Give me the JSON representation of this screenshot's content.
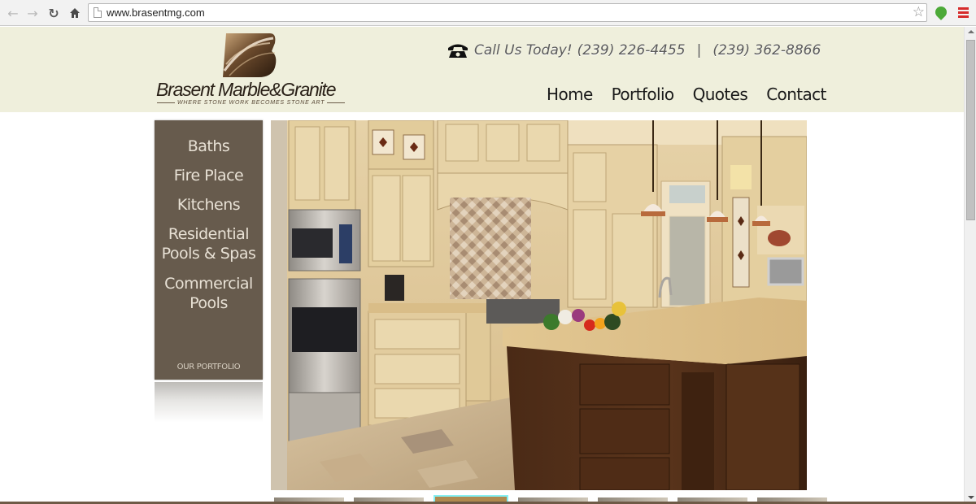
{
  "browser": {
    "url": "www.brasentmg.com",
    "back_icon": "back-arrow-icon",
    "forward_icon": "forward-arrow-icon",
    "reload_icon": "reload-icon",
    "home_icon": "home-icon",
    "bookmark_icon": "star-icon",
    "extension_icon": "green-leaf-extension-icon",
    "menu_icon": "hamburger-menu-icon"
  },
  "header": {
    "logo": {
      "name": "Brasent Marble&Granite",
      "tagline": "WHERE STONE WORK BECOMES STONE ART",
      "brand_color": "#3a2a1a"
    },
    "phone": {
      "label": "Call Us Today!",
      "primary": "(239) 226-4455",
      "separator": "|",
      "secondary": "(239) 362-8866"
    },
    "nav": [
      {
        "label": "Home"
      },
      {
        "label": "Portfolio"
      },
      {
        "label": "Quotes"
      },
      {
        "label": "Contact"
      }
    ],
    "background_color": "#efefdc"
  },
  "sidebar": {
    "items": [
      {
        "label": "Baths"
      },
      {
        "label": "Fire Place"
      },
      {
        "label": "Kitchens"
      },
      {
        "label_line1": "Residential",
        "label_line2": "Pools & Spas"
      },
      {
        "label_line1": "Commercial",
        "label_line2": "Pools"
      }
    ],
    "footer_link": "OUR PORTFOLIO",
    "background_color": "#675b4d",
    "text_color": "#e8e1d5"
  },
  "hero": {
    "subject": "kitchen with cream cabinets, granite island, pendant lights"
  },
  "thumbnails": {
    "count": 7,
    "active_index": 2,
    "active_border_color": "#86f0f3"
  }
}
